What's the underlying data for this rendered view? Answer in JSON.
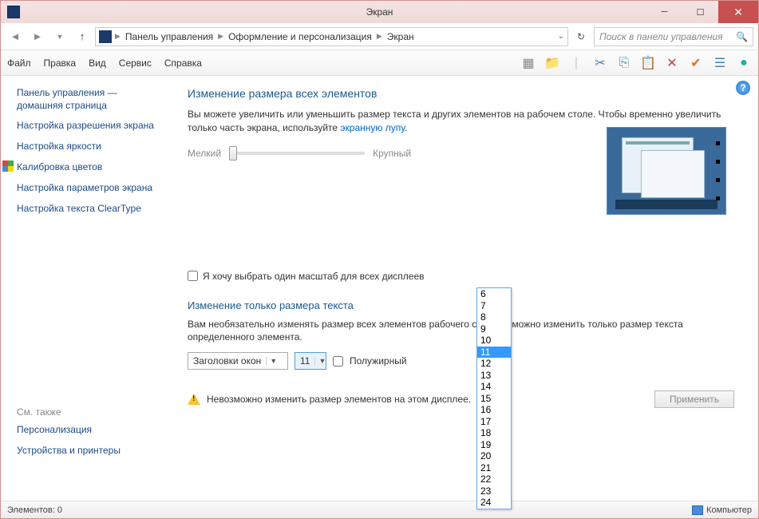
{
  "title": "Экран",
  "breadcrumbs": {
    "root": "Панель управления",
    "mid": "Оформление и персонализация",
    "leaf": "Экран"
  },
  "search_placeholder": "Поиск в панели управления",
  "menu": {
    "file": "Файл",
    "edit": "Правка",
    "view": "Вид",
    "service": "Сервис",
    "help": "Справка"
  },
  "sidebar": {
    "links": [
      "Панель управления — домашняя страница",
      "Настройка разрешения экрана",
      "Настройка яркости",
      "Калибровка цветов",
      "Настройка параметров экрана",
      "Настройка текста ClearType"
    ],
    "seealso_header": "См. также",
    "seealso": [
      "Персонализация",
      "Устройства и принтеры"
    ]
  },
  "main": {
    "heading1": "Изменение размера всех элементов",
    "para1a": "Вы можете увеличить или уменьшить размер текста и других элементов на рабочем столе. Чтобы временно увеличить только часть экрана, используйте ",
    "loupe_link": "экранную лупу",
    "period": ".",
    "slider_min": "Мелкий",
    "slider_max": "Крупный",
    "checkbox_label": "Я хочу выбрать один масштаб для всех дисплеев",
    "heading2": "Изменение только размера текста",
    "para2": "Вам необязательно изменять размер всех элементов рабочего стола — можно изменить только размер текста определенного элемента.",
    "combo1": "Заголовки окон",
    "combo2": "11",
    "bold_label": "Полужирный",
    "warning": "Невозможно изменить размер элементов на этом дисплее.",
    "apply": "Применить"
  },
  "dropdown": {
    "options": [
      "6",
      "7",
      "8",
      "9",
      "10",
      "11",
      "12",
      "13",
      "14",
      "15",
      "16",
      "17",
      "18",
      "19",
      "20",
      "21",
      "22",
      "23",
      "24"
    ],
    "selected": "11"
  },
  "status": {
    "left": "Элементов: 0",
    "right": "Компьютер"
  }
}
